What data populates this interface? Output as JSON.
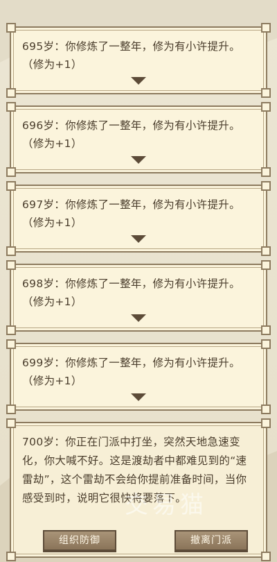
{
  "log_entries": [
    {
      "text": "695岁：你修炼了一整年，修为有小许提升。（修为+1）"
    },
    {
      "text": "696岁：你修炼了一整年，修为有小许提升。（修为+1）"
    },
    {
      "text": "697岁：你修炼了一整年，修为有小许提升。（修为+1）"
    },
    {
      "text": "698岁：你修炼了一整年，修为有小许提升。（修为+1）"
    },
    {
      "text": "699岁：你修炼了一整年，修为有小许提升。（修为+1）"
    },
    {
      "text": "700岁：你正在门派中打坐，突然天地急速变化，你大喊不好。这是渡劫者中都难见到的“速雷劫”，这个雷劫不会给你提前准备时间，当你感受到时，说明它很快将要落下。"
    }
  ],
  "buttons": {
    "defend": "组织防御",
    "withdraw": "撤离门派"
  },
  "watermark": "交易猫",
  "colors": {
    "card_bg": "#fbf4dc",
    "border": "#8c7a5e",
    "text": "#4a3d2c",
    "button": "#9a8468"
  }
}
